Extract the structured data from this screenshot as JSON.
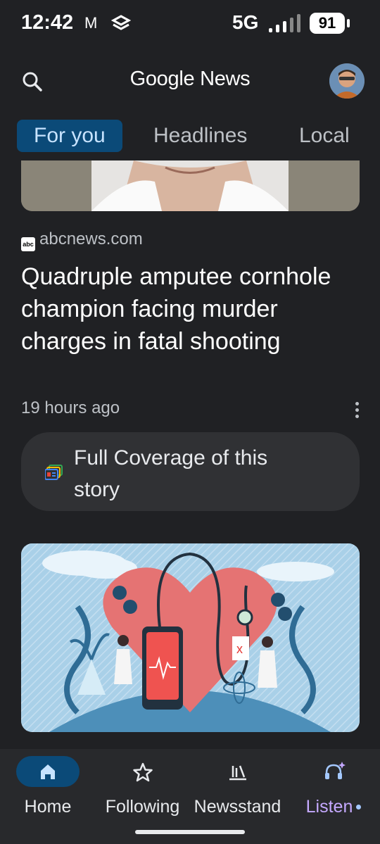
{
  "status": {
    "time": "12:42",
    "network": "5G",
    "battery": "91",
    "gmail_icon": "M"
  },
  "header": {
    "title": "Google News"
  },
  "tabs": [
    {
      "label": "For you",
      "active": true
    },
    {
      "label": "Headlines",
      "active": false
    },
    {
      "label": "Local",
      "active": false
    }
  ],
  "article": {
    "source": "abcnews.com",
    "source_logo": "abc",
    "headline": "Quadruple amputee cornhole champion facing murder charges in fatal shooting",
    "time_ago": "19 hours ago"
  },
  "coverage": {
    "label": "Full Coverage of this story"
  },
  "bottom_nav": {
    "home": "Home",
    "following": "Following",
    "newsstand": "Newsstand",
    "listen": "Listen"
  },
  "colors": {
    "background": "#202124",
    "accent_tab": "#0b4a78",
    "listen": "#c5a9ff"
  }
}
